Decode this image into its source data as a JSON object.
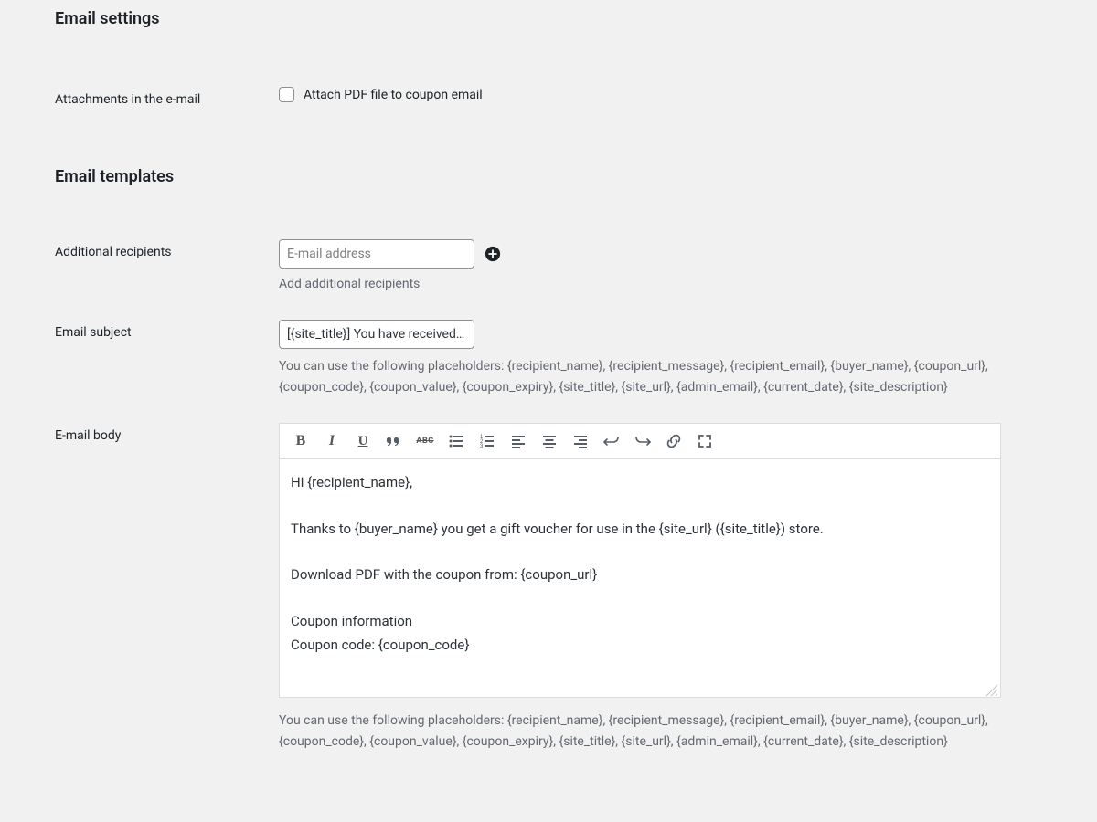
{
  "sections": {
    "email_settings": "Email settings",
    "email_templates": "Email templates"
  },
  "attachments": {
    "label": "Attachments in the e-mail",
    "checkbox_label": "Attach PDF file to coupon email"
  },
  "recipients": {
    "label": "Additional recipients",
    "placeholder": "E-mail address",
    "help": "Add additional recipients"
  },
  "subject": {
    "label": "Email subject",
    "value": "[{site_title}] You have received a gift voucher",
    "placeholders_help": "You can use the following placeholders: {recipient_name}, {recipient_message}, {recipient_email}, {buyer_name}, {coupon_url}, {coupon_code}, {coupon_value}, {coupon_expiry}, {site_title}, {site_url}, {admin_email}, {current_date}, {site_description}"
  },
  "body": {
    "label": "E-mail body",
    "lines": {
      "l1": "Hi {recipient_name},",
      "l2": "Thanks to {buyer_name} you get a gift voucher for use in the {site_url} ({site_title}) store.",
      "l3": "Download PDF with the coupon from: {coupon_url}",
      "l4": "Coupon information",
      "l5": "Coupon code: {coupon_code}"
    },
    "placeholders_help": "You can use the following placeholders: {recipient_name}, {recipient_message}, {recipient_email}, {buyer_name}, {coupon_url}, {coupon_code}, {coupon_value}, {coupon_expiry}, {site_title}, {site_url}, {admin_email}, {current_date}, {site_description}"
  },
  "toolbar": {
    "bold": "B",
    "italic": "I",
    "underline": "U",
    "strike": "ABC"
  }
}
